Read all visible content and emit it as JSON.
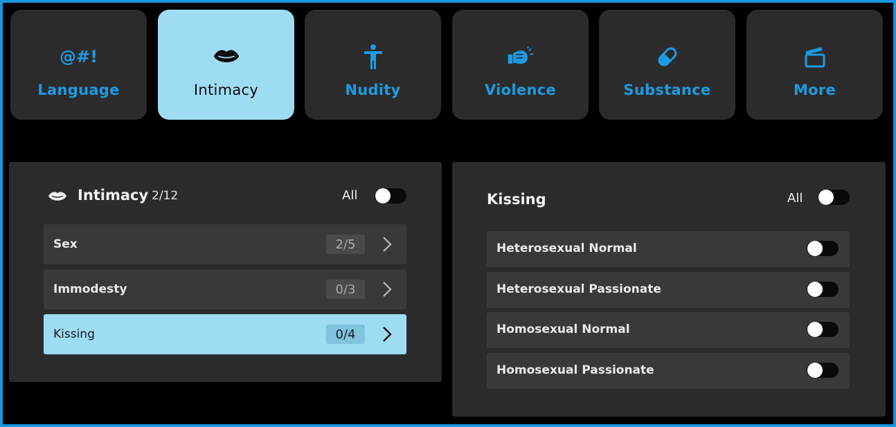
{
  "tabs": [
    {
      "label": "Language",
      "icon": "symbols-icon",
      "icon_text": "@#!",
      "active": false
    },
    {
      "label": "Intimacy",
      "icon": "lips-icon",
      "active": true
    },
    {
      "label": "Nudity",
      "icon": "person-icon",
      "active": false
    },
    {
      "label": "Violence",
      "icon": "punch-icon",
      "active": false
    },
    {
      "label": "Substance",
      "icon": "pill-icon",
      "active": false
    },
    {
      "label": "More",
      "icon": "clapperboard-icon",
      "active": false
    }
  ],
  "left_panel": {
    "title": "Intimacy",
    "count": "2/12",
    "all_label": "All",
    "all_on": false,
    "items": [
      {
        "label": "Sex",
        "count": "2/5",
        "active": false
      },
      {
        "label": "Immodesty",
        "count": "0/3",
        "active": false
      },
      {
        "label": "Kissing",
        "count": "0/4",
        "active": true
      }
    ]
  },
  "right_panel": {
    "title": "Kissing",
    "all_label": "All",
    "all_on": false,
    "options": [
      {
        "label": "Heterosexual Normal",
        "on": false
      },
      {
        "label": "Heterosexual Passionate",
        "on": false
      },
      {
        "label": "Homosexual Normal",
        "on": false
      },
      {
        "label": "Homosexual Passionate",
        "on": false
      }
    ]
  },
  "colors": {
    "accent": "#1d9be2",
    "active_bg": "#9edcf3",
    "panel_bg": "#2b2b2b",
    "row_bg": "#393939",
    "frame": "#1896e0"
  }
}
